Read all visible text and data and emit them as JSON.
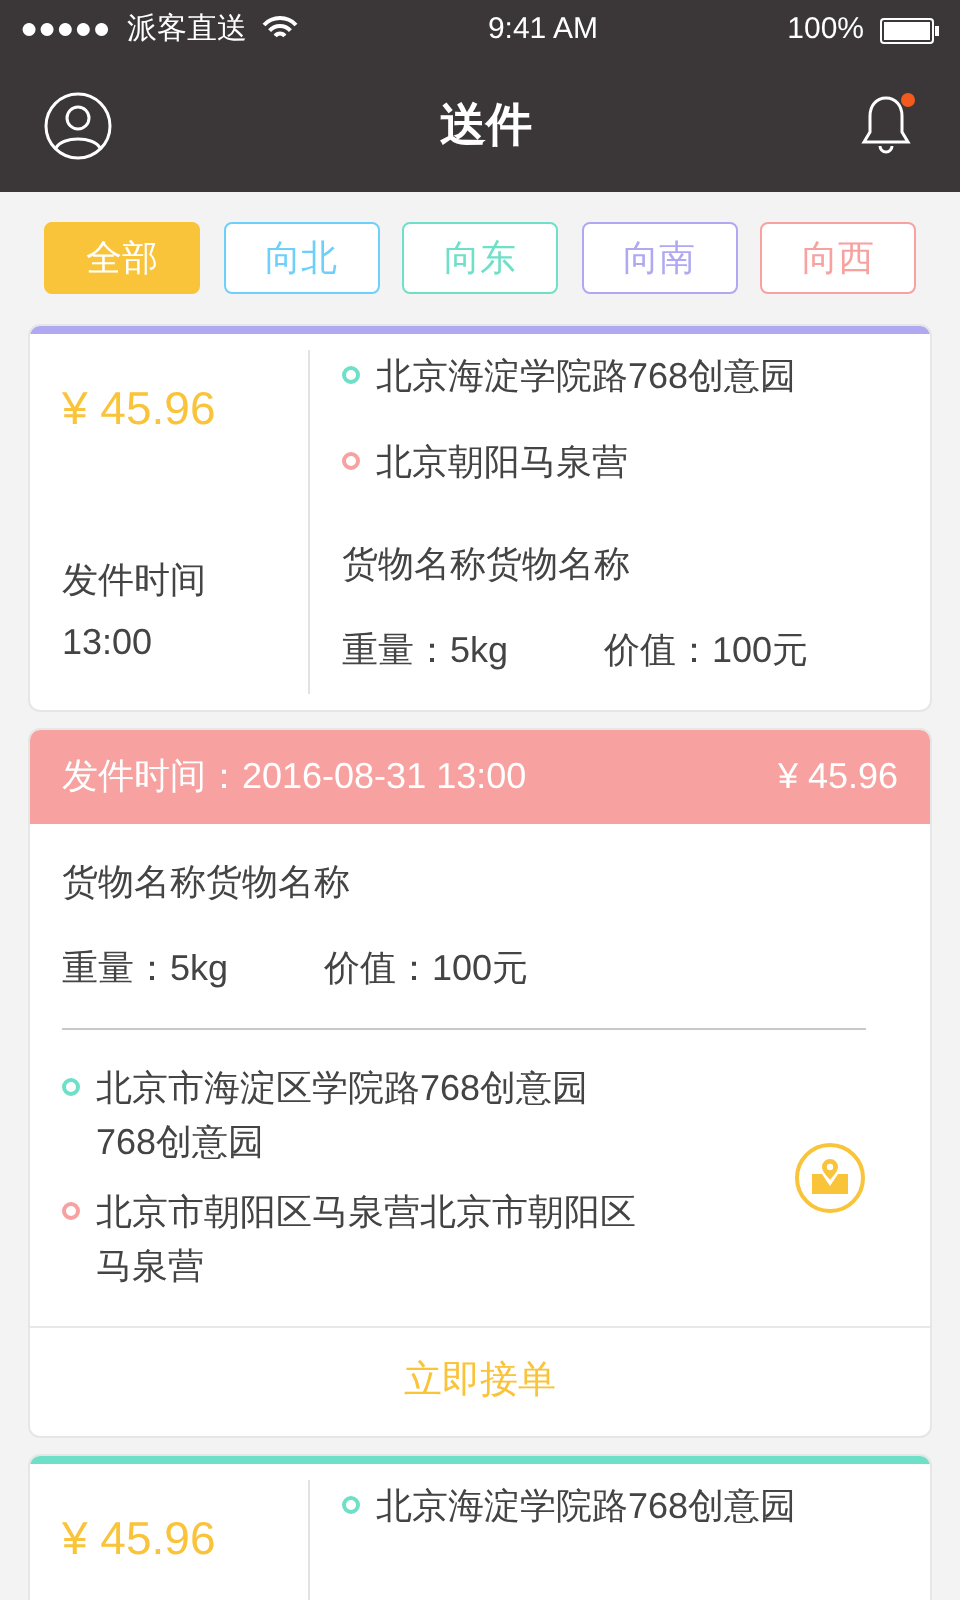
{
  "status_bar": {
    "signal": "●●●●●",
    "carrier": "派客直送",
    "time": "9:41 AM",
    "battery": "100%"
  },
  "nav": {
    "title": "送件",
    "has_notification": true
  },
  "filters": [
    {
      "label": "全部",
      "selected": true,
      "color": "#f9c33a"
    },
    {
      "label": "向北",
      "selected": false,
      "color": "#6dd0fb"
    },
    {
      "label": "向东",
      "selected": false,
      "color": "#6fe0c8"
    },
    {
      "label": "向南",
      "selected": false,
      "color": "#b0a8f0"
    },
    {
      "label": "向西",
      "selected": false,
      "color": "#f7a1a0"
    }
  ],
  "orders": [
    {
      "kind": "compact",
      "color": "#b0a8f0",
      "price": "¥ 45.96",
      "time_label": "发件时间",
      "time": "13:00",
      "from": "北京海淀学院路768创意园",
      "to": "北京朝阳马泉营",
      "goods": "货物名称货物名称",
      "weight": "重量：5kg",
      "value": "价值：100元"
    },
    {
      "kind": "expanded",
      "color": "#f7a1a0",
      "time_line": "发件时间：2016-08-31 13:00",
      "price": "¥ 45.96",
      "goods": "货物名称货物名称",
      "weight": "重量：5kg",
      "value": "价值：100元",
      "from": "北京市海淀区学院路768创意园768创意园",
      "to": "北京市朝阳区马泉营北京市朝阳区马泉营",
      "action": "立即接单"
    },
    {
      "kind": "compact",
      "color": "#6fe0c8",
      "price": "¥ 45.96",
      "from": "北京海淀学院路768创意园"
    }
  ]
}
